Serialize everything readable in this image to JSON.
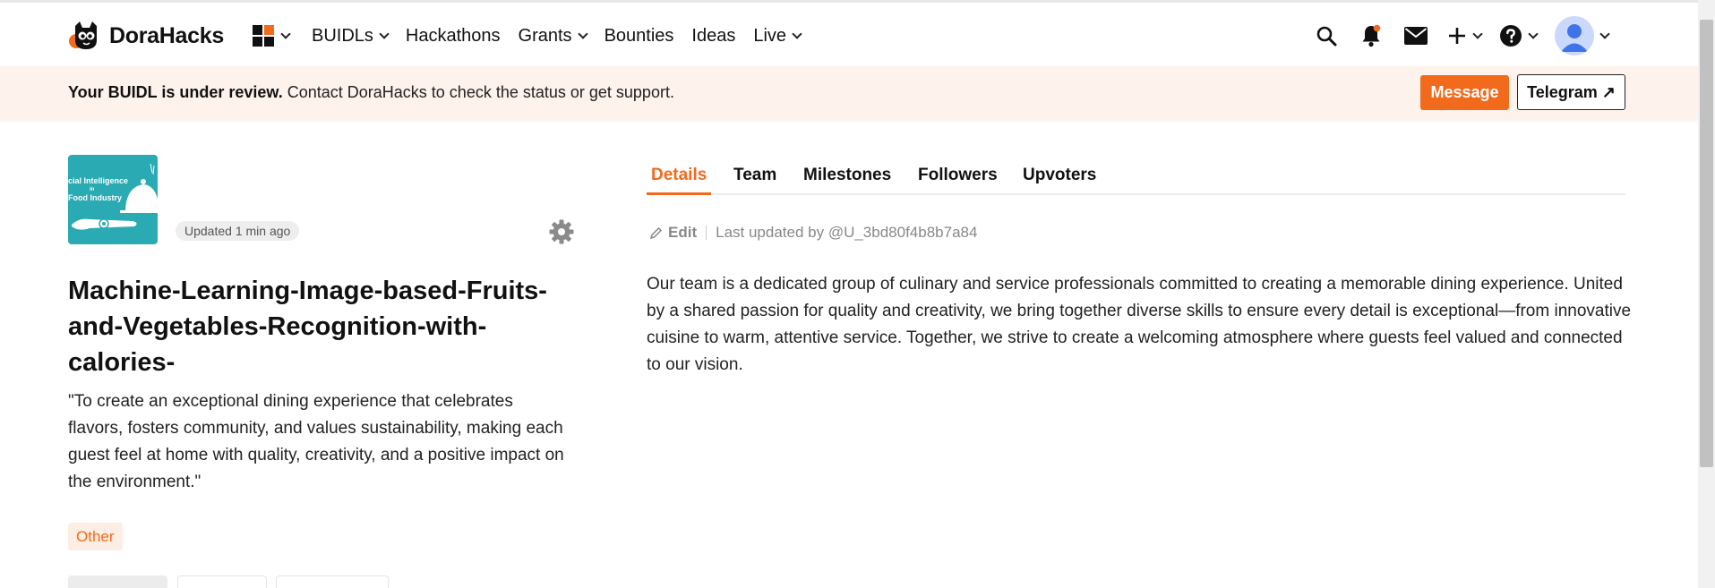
{
  "brand": {
    "name": "DoraHacks",
    "accent": "#f26a1b"
  },
  "nav": {
    "items": [
      {
        "label": "BUIDLs",
        "dropdown": true
      },
      {
        "label": "Hackathons",
        "dropdown": false
      },
      {
        "label": "Grants",
        "dropdown": true
      },
      {
        "label": "Bounties",
        "dropdown": false
      },
      {
        "label": "Ideas",
        "dropdown": false
      },
      {
        "label": "Live",
        "dropdown": true
      }
    ],
    "icons": [
      "apps-grid-icon",
      "search-icon",
      "bell-icon",
      "mail-icon",
      "plus-icon",
      "help-icon",
      "avatar"
    ]
  },
  "banner": {
    "bold": "Your BUIDL is under review.",
    "text": " Contact DoraHacks to check the status or get support.",
    "message_label": "Message",
    "telegram_label": "Telegram ↗"
  },
  "project": {
    "thumbnail_text": [
      "cial Intelligence",
      "in",
      "Food Industry"
    ],
    "updated": "Updated 1 min ago",
    "title": "Machine-Learning-Image-based-Fruits-and-Vegetables-Recognition-with-calories-",
    "tagline": "\"To create an exceptional dining experience that celebrates flavors, fosters community, and values sustainability, making each guest feel at home with quality, creativity, and a positive impact on the environment.\"",
    "tag": "Other"
  },
  "tabs": [
    {
      "label": "Details",
      "active": true
    },
    {
      "label": "Team",
      "active": false
    },
    {
      "label": "Milestones",
      "active": false
    },
    {
      "label": "Followers",
      "active": false
    },
    {
      "label": "Upvoters",
      "active": false
    }
  ],
  "details": {
    "edit_label": "Edit",
    "last_updated": "Last updated by @U_3bd80f4b8b7a84",
    "description": "Our team is a dedicated group of culinary and service professionals committed to creating a memorable dining experience. United by a shared passion for quality and creativity, we bring together diverse skills to ensure every detail is exceptional—from innovative cuisine to warm, attentive service. Together, we strive to create a welcoming atmosphere where guests feel valued and connected to our vision."
  }
}
